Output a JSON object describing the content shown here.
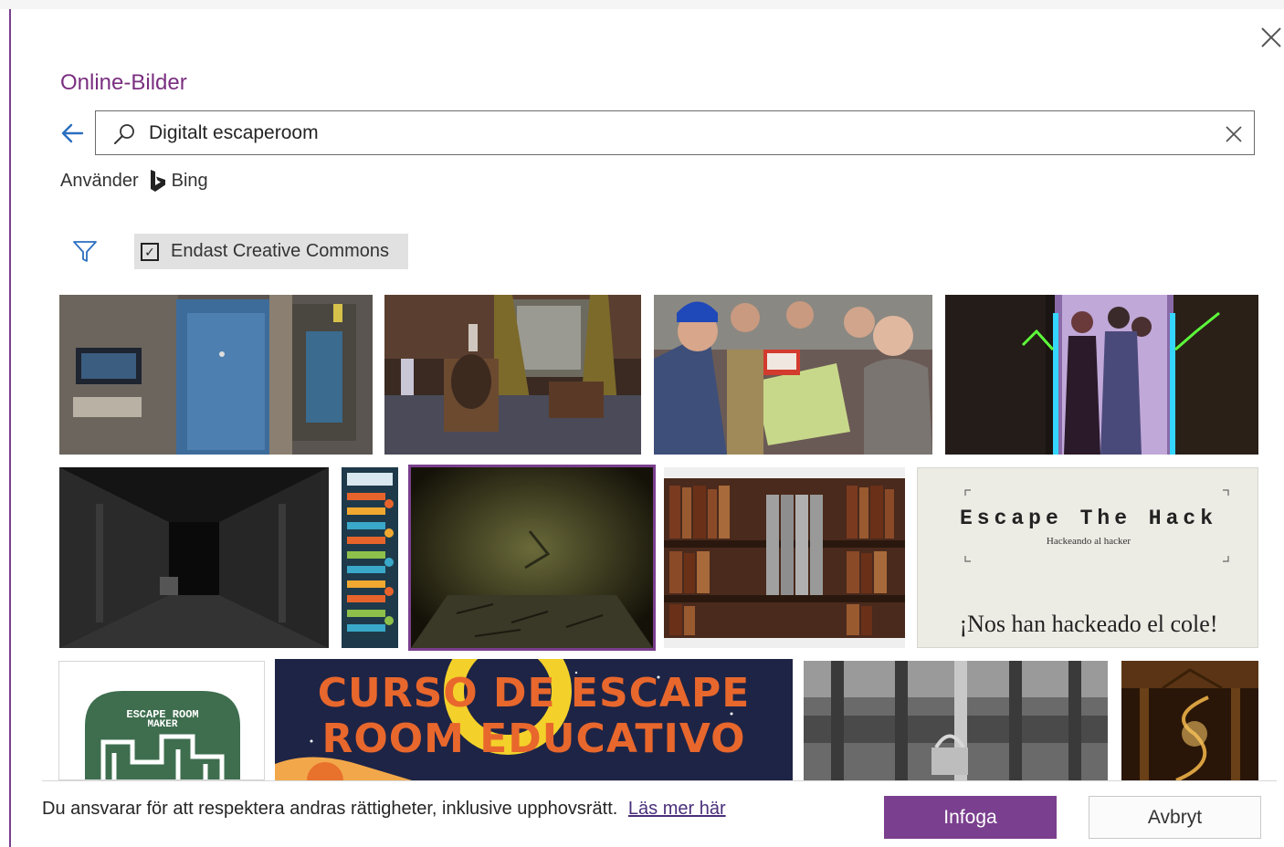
{
  "dialog": {
    "title": "Online-Bilder",
    "search_value": "Digitalt escaperoom",
    "using_prefix": "Använder",
    "provider": "Bing",
    "cc_label": "Endast Creative Commons",
    "cc_checked": true
  },
  "thumbnails": [
    {
      "name": "thumb-industrial-door"
    },
    {
      "name": "thumb-victorian-room"
    },
    {
      "name": "thumb-group-photo"
    },
    {
      "name": "thumb-neon-figures"
    },
    {
      "name": "thumb-dark-corridor"
    },
    {
      "name": "thumb-infographic"
    },
    {
      "name": "thumb-cave-wall"
    },
    {
      "name": "thumb-bookshelf"
    },
    {
      "name": "thumb-escape-the-hack"
    },
    {
      "name": "thumb-escape-room-maker"
    },
    {
      "name": "thumb-curso-escape-room"
    },
    {
      "name": "thumb-bw-lock"
    },
    {
      "name": "thumb-spiral-stairs"
    }
  ],
  "image_text": {
    "hack_title": "Escape The Hack",
    "hack_sub": "Hackeando al hacker",
    "hack_bottom": "¡Nos han hackeado el cole!",
    "maker_line1": "ESCAPE ROOM",
    "maker_line2": "MAKER",
    "curso_line1": "CURSO DE ESCAPE",
    "curso_line2": "ROOM EDUCATIVO"
  },
  "footer": {
    "disclaimer": "Du ansvarar för att respektera andras rättigheter, inklusive upphovsrätt.",
    "learn_more": "Läs mer här",
    "insert": "Infoga",
    "cancel": "Avbryt"
  },
  "colors": {
    "accent": "#7a3f8e",
    "title": "#7a2f80",
    "cc_bg": "#e1e1e1"
  }
}
